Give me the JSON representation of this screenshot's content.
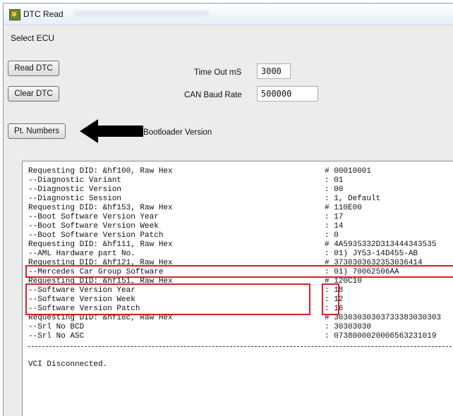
{
  "window": {
    "title": "DTC Read"
  },
  "menu": {
    "select_ecu": "Select ECU"
  },
  "buttons": {
    "read_dtc": "Read DTC",
    "clear_dtc": "Clear DTC",
    "pt_numbers": "Pt. Numbers"
  },
  "fields": {
    "timeout_label": "Time Out mS",
    "timeout_value": "3000",
    "baud_label": "CAN Baud Rate",
    "baud_value": "500000",
    "bootloader_label": "le Bootloader Version"
  },
  "console": {
    "lines": [
      {
        "label": "Requesting DID: &hf100, Raw Hex",
        "value": "# 00010001"
      },
      {
        "label": "--Diagnostic Variant",
        "value": ": 01"
      },
      {
        "label": "--Diagnostic Version",
        "value": ": 00"
      },
      {
        "label": "--Diagnostic Session",
        "value": ": 1, Default"
      },
      {
        "label": "Requesting DID: &hf153, Raw Hex",
        "value": "# 110E00"
      },
      {
        "label": "--Boot Software Version Year",
        "value": ": 17"
      },
      {
        "label": "--Boot Software Version Week",
        "value": ": 14"
      },
      {
        "label": "--Boot Software Version Patch",
        "value": ": 0"
      },
      {
        "label": "Requesting DID: &hf111, Raw Hex",
        "value": "# 4A5935332D313444343535"
      },
      {
        "label": "--AML Hardware part No.",
        "value": ": 01) JY53-14D455-AB"
      },
      {
        "label": "Requesting DID: &hf121, Raw Hex",
        "value": "# 3730303632353036414"
      },
      {
        "label": "--Mercedes Car Group Software",
        "value": ": 01) 70062506AA"
      },
      {
        "label": "Requesting DID: &hf151, Raw Hex",
        "value": "# 120C10"
      },
      {
        "label": "--Software Version Year",
        "value": ": 18"
      },
      {
        "label": "--Software Version Week",
        "value": ": 12"
      },
      {
        "label": "--Software Version Patch",
        "value": ": 16"
      },
      {
        "label": "Requesting DID: &hf18c, Raw Hex",
        "value": "# 30303030303733383030303"
      },
      {
        "label": "--Srl No BCD",
        "value": ": 30303030"
      },
      {
        "label": "--Srl No ASC",
        "value": ": 0738000020006563231019"
      }
    ],
    "status": "VCI Disconnected."
  }
}
